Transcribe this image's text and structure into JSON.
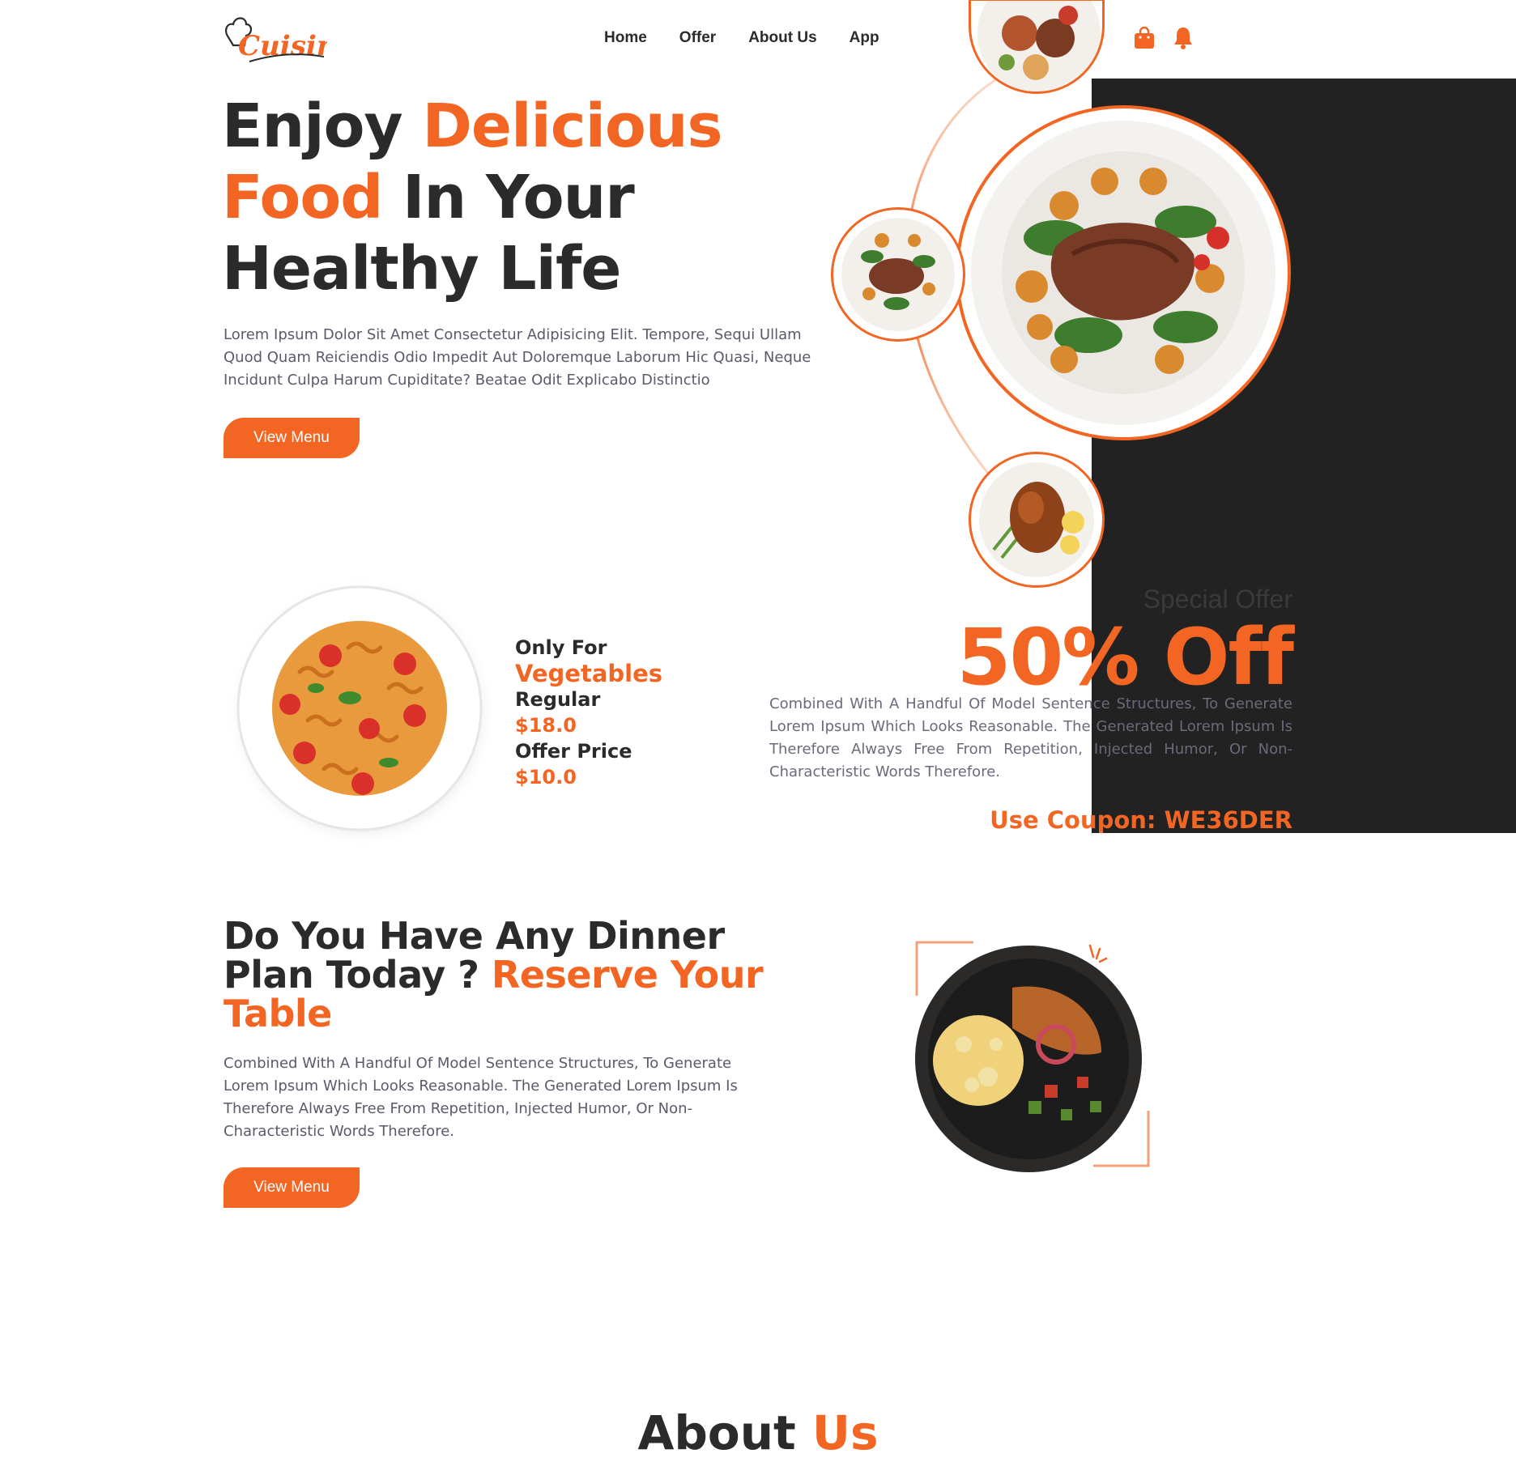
{
  "brand": {
    "logo_text": "Cuisine",
    "accent": "#f26522",
    "dark": "#222222"
  },
  "nav": {
    "items": [
      "Home",
      "Offer",
      "About Us",
      "App"
    ]
  },
  "header_icons": [
    "shopping-bag-icon",
    "bell-icon"
  ],
  "hero": {
    "title_1": "Enjoy",
    "title_2": "Delicious",
    "title_3": "Food",
    "title_4": "In Your",
    "title_5": "Healthy Life",
    "text": "Lorem Ipsum Dolor Sit Amet Consectetur Adipisicing Elit. Tempore, Sequi Ullam Quod Quam Reiciendis Odio Impedit Aut Doloremque Laborum Hic Quasi, Neque Incidunt Culpa Harum Cupiditate? Beatae Odit Explicabo Distinctio",
    "button": "View Menu"
  },
  "offer": {
    "only_for": "Only For",
    "category": "Vegetables",
    "regular_label": "Regular",
    "regular_price": "$18.0",
    "offer_label": "Offer Price",
    "offer_price": "$10.0",
    "special": "Special Offer",
    "big": "50% Off",
    "text": "Combined With A Handful Of Model Sentence Structures, To Generate Lorem Ipsum Which Looks Reasonable. The Generated Lorem Ipsum Is Therefore Always Free From Repetition, Injected Humor, Or Non-Characteristic Words Therefore.",
    "coupon": "Use Coupon: WE36DER"
  },
  "reserve": {
    "title_1": "Do You Have Any Dinner Plan Today ?",
    "title_2": "Reserve Your Table",
    "text": "Combined With A Handful Of Model Sentence Structures, To Generate Lorem Ipsum Which Looks Reasonable. The Generated Lorem Ipsum Is Therefore Always Free From Repetition, Injected Humor, Or Non-Characteristic Words Therefore.",
    "button": "View Menu"
  },
  "about": {
    "title_1": "About",
    "title_2": "Us"
  }
}
